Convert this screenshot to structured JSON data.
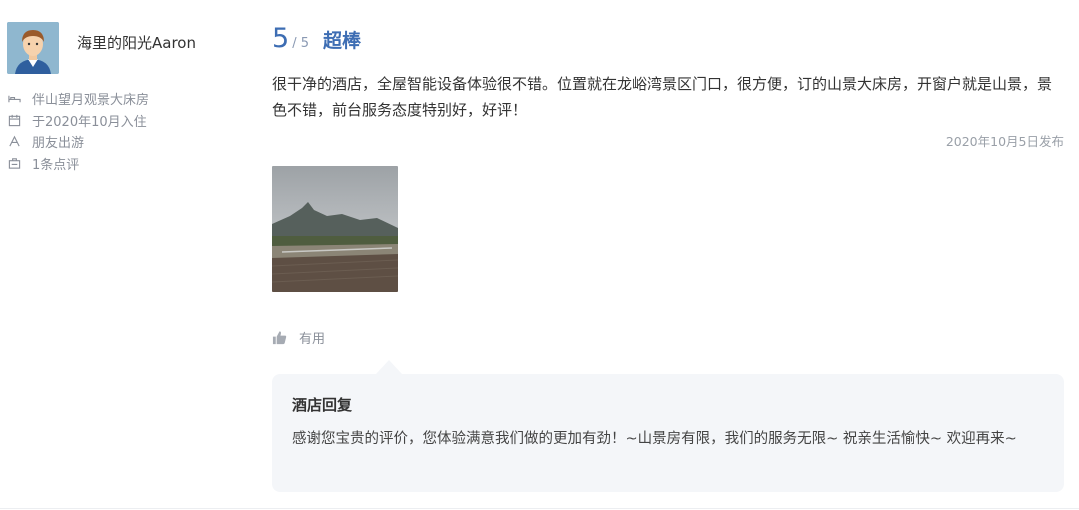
{
  "reviewer": {
    "name": "海里的阳光Aaron",
    "meta": [
      {
        "icon": "bed-icon",
        "text": "伴山望月观景大床房"
      },
      {
        "icon": "calendar-icon",
        "text": "于2020年10月入住"
      },
      {
        "icon": "travel-type-icon",
        "text": "朋友出游"
      },
      {
        "icon": "review-count-icon",
        "text": "1条点评"
      }
    ]
  },
  "review": {
    "score": "5",
    "score_total": "/ 5",
    "rating_label": "超棒",
    "text": "很干净的酒店，全屋智能设备体验很不错。位置就在龙峪湾景区门口，很方便，订的山景大床房，开窗户就是山景，景色不错，前台服务态度特别好，好评！",
    "date": "2020年10月5日发布",
    "photo_count": 1
  },
  "helpful": {
    "icon": "thumbs-up-icon",
    "label": "有用"
  },
  "reply": {
    "title": "酒店回复",
    "text": "感谢您宝贵的评价，您体验满意我们做的更加有劲！~山景房有限，我们的服务无限~ 祝亲生活愉快~ 欢迎再来~"
  },
  "colors": {
    "accent": "#3d6db3",
    "muted": "#8a8f99",
    "reply_bg": "#f4f6f9"
  }
}
